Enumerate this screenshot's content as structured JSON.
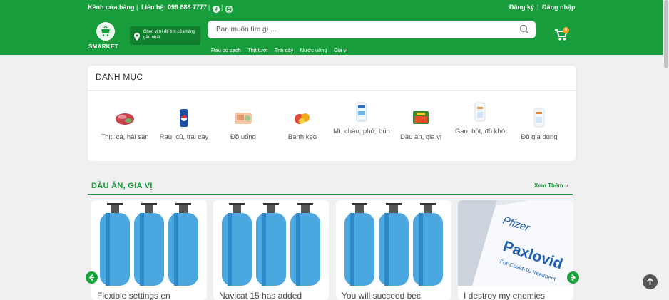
{
  "topbar": {
    "store_channel": "Kênh cửa hàng",
    "contact": "Liên hệ: 099 888 7777",
    "register": "Đăng ký",
    "login": "Đăng nhập"
  },
  "brand": {
    "name": "SMARKET"
  },
  "location": {
    "text": "Chọn vị trí để tìm cửa hàng gần nhất"
  },
  "search": {
    "placeholder": "Bạn muốn tìm gì ..."
  },
  "quick_links": [
    "Rau củ sạch",
    "Thịt tươi",
    "Trái cây",
    "Nước uống",
    "Gia vị"
  ],
  "categories": {
    "title": "DANH MỤC",
    "items": [
      {
        "label": "Thịt, cá, hải sản"
      },
      {
        "label": "Rau, củ, trái cây"
      },
      {
        "label": "Đồ uống"
      },
      {
        "label": "Bánh kẹo"
      },
      {
        "label": "Mì, cháo, phở, bún"
      },
      {
        "label": "Dầu ăn, gia vị"
      },
      {
        "label": "Gạo, bột, đồ khô"
      },
      {
        "label": "Đồ gia dụng"
      }
    ]
  },
  "section": {
    "title": "DẦU ĂN, GIA VỊ",
    "more": "Xem Thêm"
  },
  "products": [
    {
      "title": "Flexible settings en"
    },
    {
      "title": "Navicat 15 has added"
    },
    {
      "title": "You will succeed bec"
    },
    {
      "title": "I destroy my enemies"
    }
  ],
  "product_image_text": {
    "brand": "Pfizer",
    "name": "Paxlovid",
    "sub": "For Covid-19 treatment"
  },
  "colors": {
    "brand_green": "#179d3b",
    "badge_orange": "#f59b1c"
  }
}
